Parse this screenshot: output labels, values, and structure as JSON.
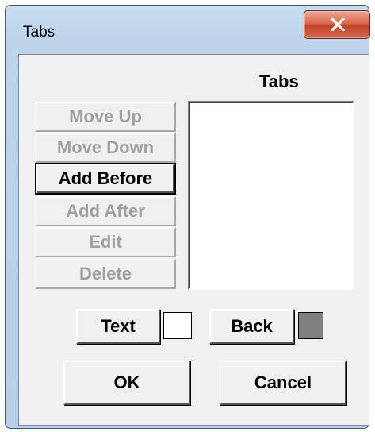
{
  "window": {
    "title": "Tabs",
    "close_icon": "close-x-icon",
    "close_color": "#c2432a"
  },
  "dialog": {
    "list_header": "Tabs",
    "list_items": [],
    "buttons": {
      "move_up": "Move Up",
      "move_down": "Move Down",
      "add_before": "Add Before",
      "add_after": "Add After",
      "edit": "Edit",
      "delete": "Delete",
      "text": "Text",
      "back": "Back",
      "ok": "OK",
      "cancel": "Cancel"
    },
    "swatches": {
      "text_color": "#ffffff",
      "back_color": "#808080"
    }
  }
}
